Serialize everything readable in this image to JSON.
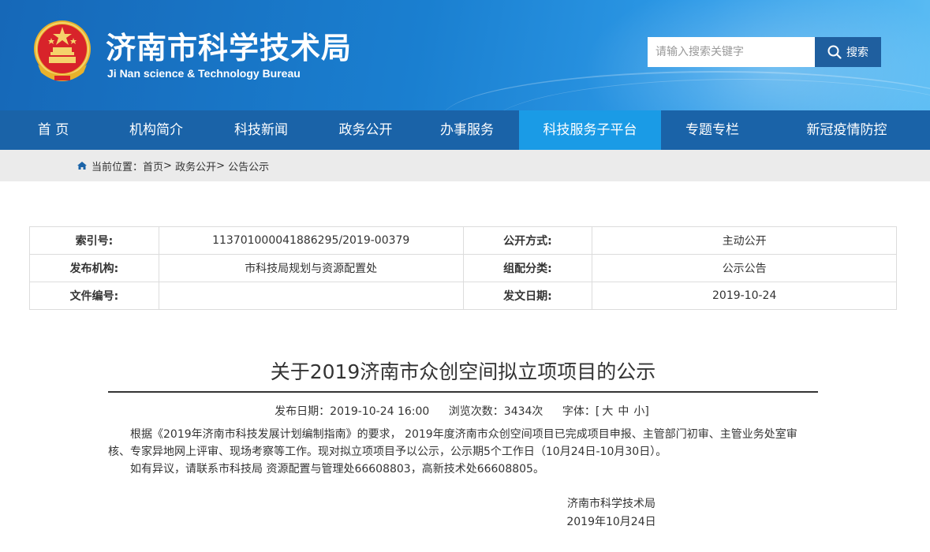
{
  "header": {
    "title": "济南市科学技术局",
    "subtitle": "Ji Nan science & Technology Bureau",
    "search_placeholder": "请输入搜索关键字",
    "search_button": "搜索",
    "emblem_icon": "national-emblem-icon"
  },
  "nav": {
    "items": [
      {
        "label": "首 页",
        "active": false
      },
      {
        "label": "机构简介",
        "active": false
      },
      {
        "label": "科技新闻",
        "active": false
      },
      {
        "label": "政务公开",
        "active": false
      },
      {
        "label": "办事服务",
        "active": false
      },
      {
        "label": "科技服务子平台",
        "active": true
      },
      {
        "label": "专题专栏",
        "active": false
      },
      {
        "label": "新冠疫情防控",
        "active": false
      }
    ]
  },
  "breadcrumb": {
    "prefix": "当前位置：",
    "items": [
      "首页",
      "政务公开",
      "公告公示"
    ],
    "separator": ">"
  },
  "info": {
    "index_label": "索引号:",
    "index_value": "11370100004188629 5/2019-00379",
    "open_method_label": "公开方式:",
    "open_method_value": "主动公开",
    "publisher_label": "发布机构:",
    "publisher_value": "市科技局规划与资源配置处",
    "category_label": "组配分类:",
    "category_value": "公示公告",
    "doc_no_label": "文件编号:",
    "doc_no_value": "",
    "issue_date_label": "发文日期:",
    "issue_date_value": "2019-10-24"
  },
  "article": {
    "title": "关于2019济南市众创空间拟立项项目的公示",
    "publish_date": "发布日期：2019-10-24 16:00",
    "views": "浏览次数：3434次",
    "font_size_label": "字体：[",
    "font_large": "大",
    "font_medium": "中",
    "font_small": "小]",
    "para1": "根据《2019年济南市科技发展计划编制指南》的要求， 2019年度济南市众创空间项目已完成项目申报、主管部门初审、主管业务处室审核、专家异地网上评审、现场考察等工作。现对拟立项项目予以公示，公示期5个工作日（10月24日-10月30日）。",
    "para2": "如有异议，请联系市科技局 资源配置与管理处66608803，高新技术处66608805。",
    "sign_org": "济南市科学技术局",
    "sign_date": "2019年10月24日"
  },
  "colors": {
    "nav_bg": "#1a63a8",
    "nav_active": "#1a9be6",
    "search_button": "#1f5f9f"
  }
}
